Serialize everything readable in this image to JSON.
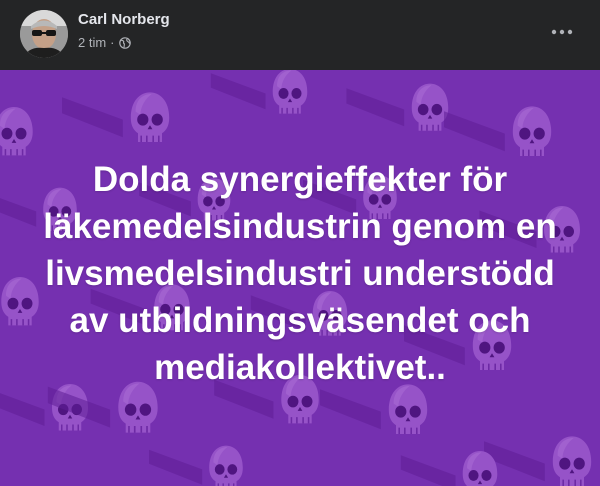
{
  "post": {
    "author": "Carl Norberg",
    "time": "2 tim",
    "separator": "·",
    "audience_icon": "globe-icon",
    "more_icon": "more-options-icon"
  },
  "media": {
    "background_color": "#7530b0",
    "pattern_icon": "skull-icon",
    "headline_lines": [
      "Dolda synergieffekter för",
      "läkemedelsindustrin genom en",
      "livsmedelsindustri understödd",
      "av utbildningsväsendet och",
      "mediakollektivet.."
    ]
  }
}
